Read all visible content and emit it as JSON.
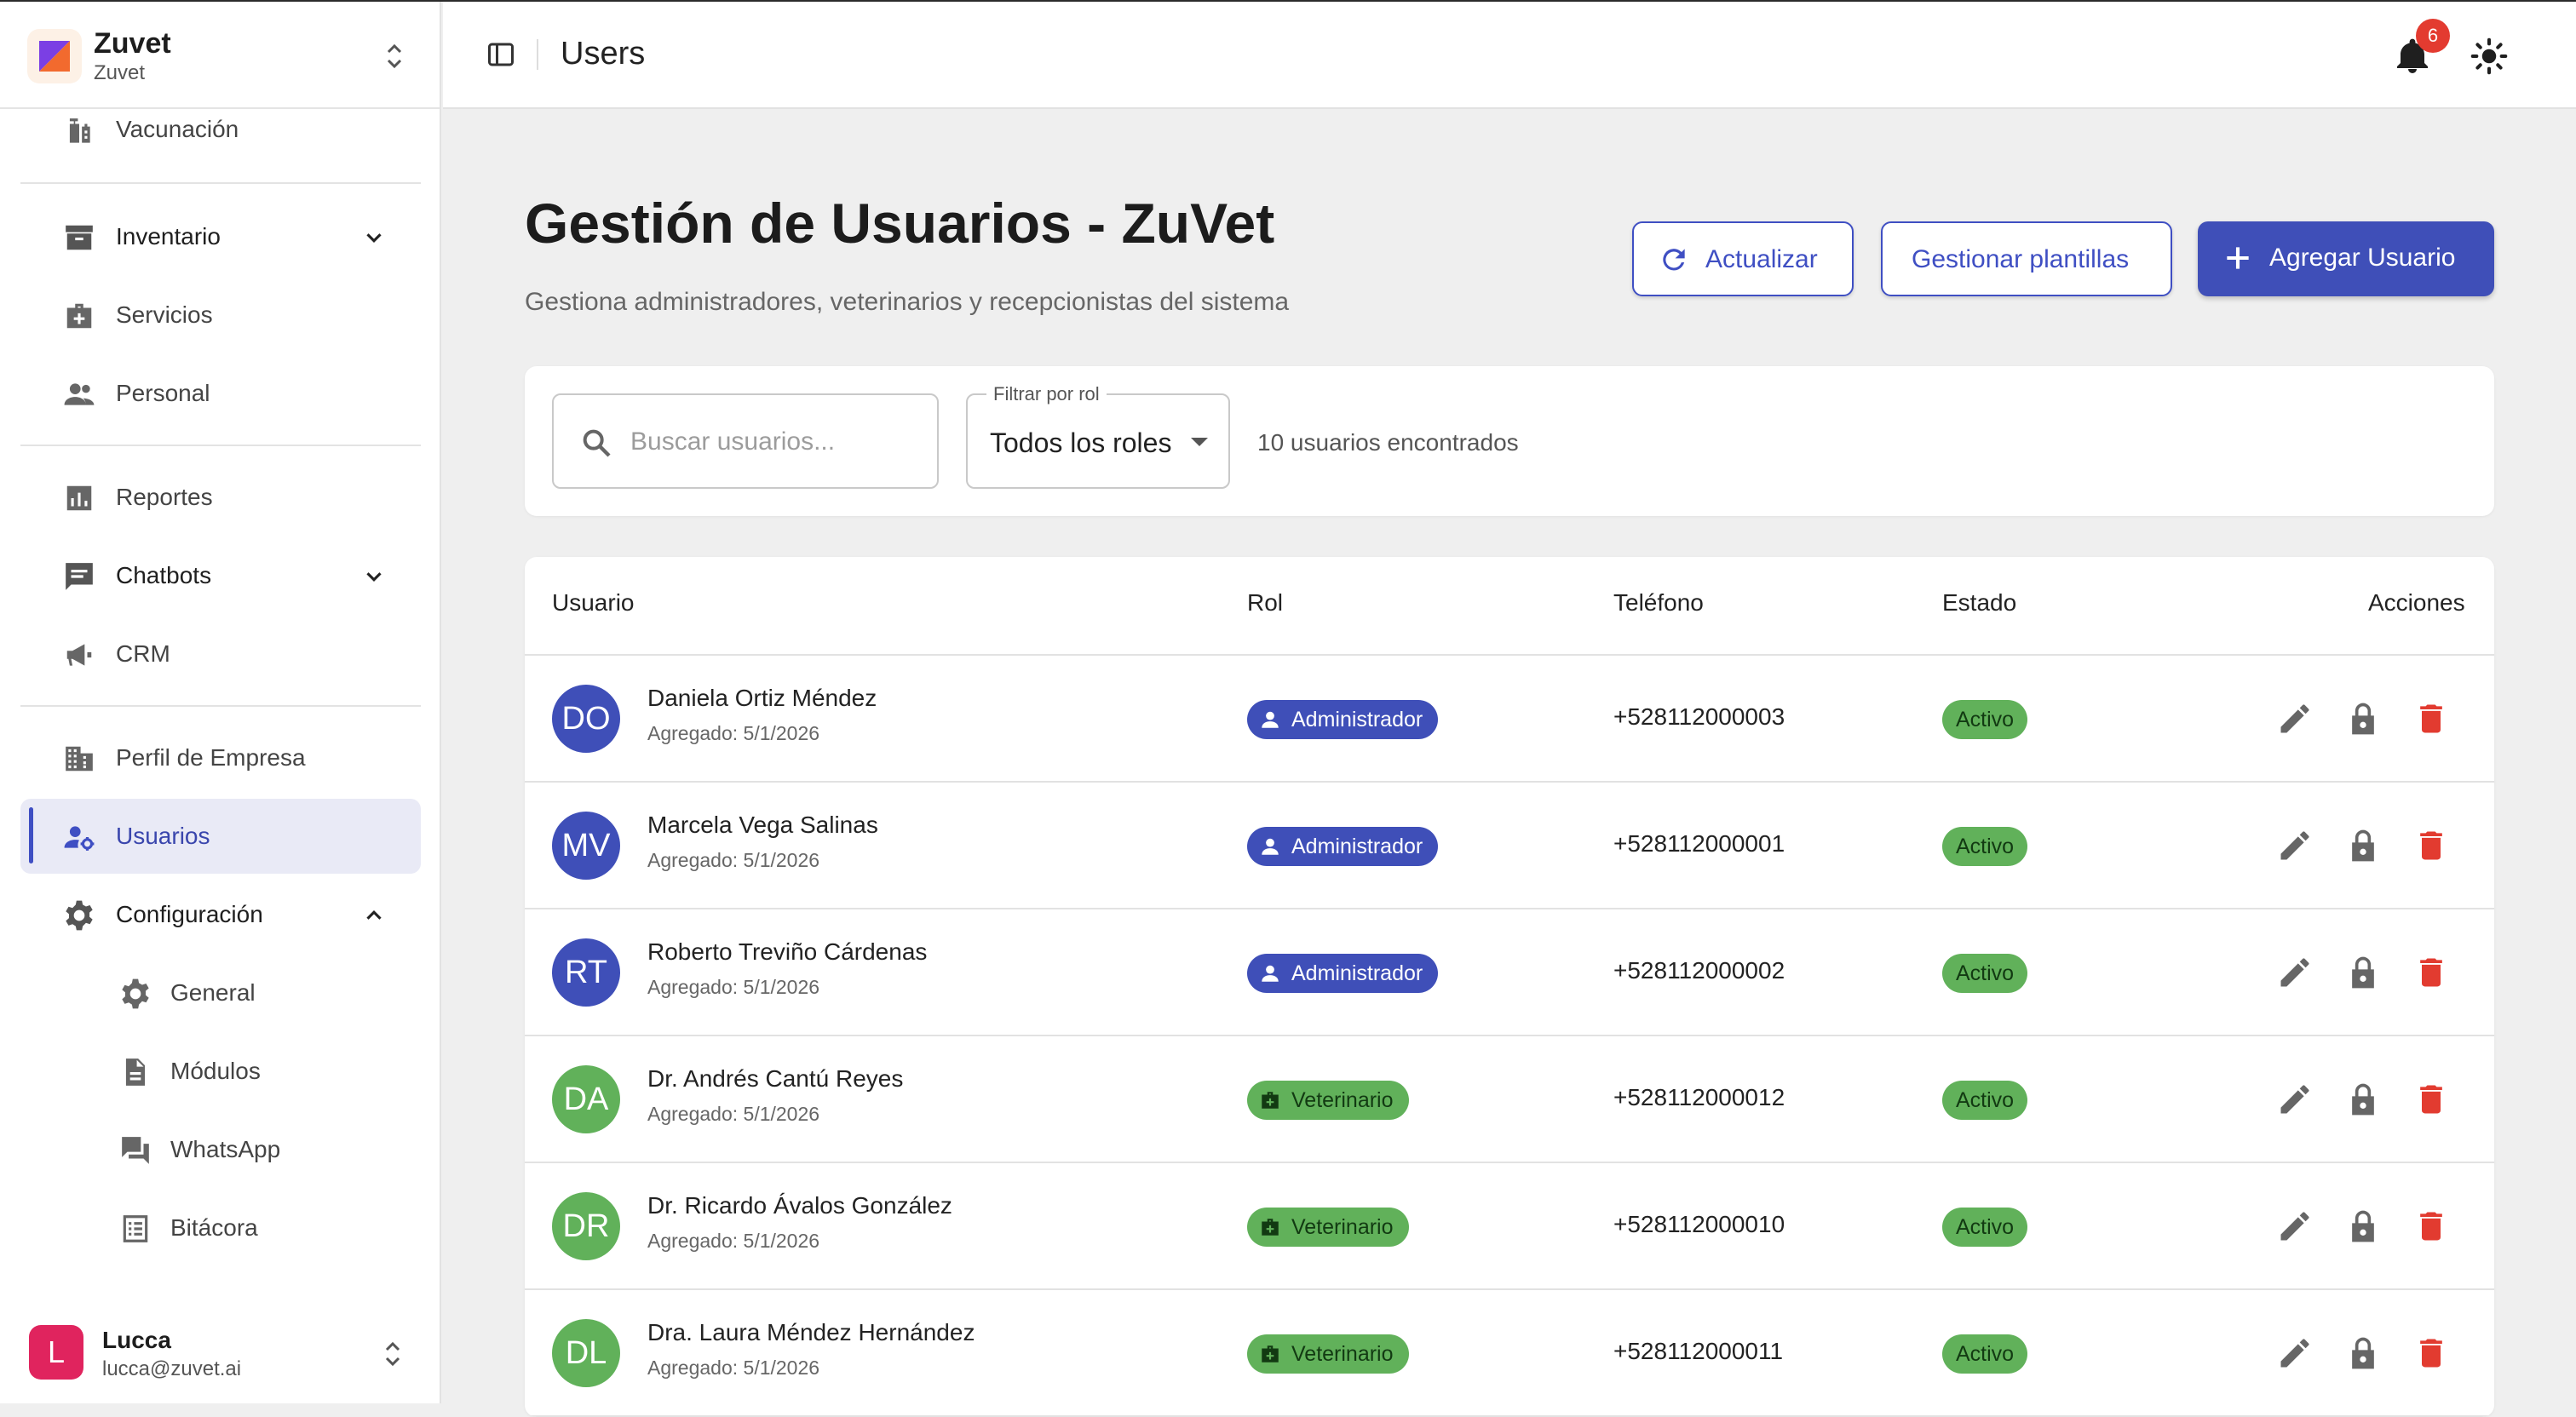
{
  "app": {
    "brand_name": "Zuvet",
    "brand_sub": "Zuvet",
    "accent": "#3f4fb8",
    "header_title": "Users",
    "notification_count": "6"
  },
  "sidebar": {
    "items": {
      "vacunacion": "Vacunación",
      "inventario": "Inventario",
      "servicios": "Servicios",
      "personal": "Personal",
      "reportes": "Reportes",
      "chatbots": "Chatbots",
      "crm": "CRM",
      "perfil": "Perfil de Empresa",
      "usuarios": "Usuarios",
      "configuracion": "Configuración",
      "general": "General",
      "modulos": "Módulos",
      "whatsapp": "WhatsApp",
      "bitacora": "Bitácora"
    },
    "user": {
      "initial": "L",
      "name": "Lucca",
      "email": "lucca@zuvet.ai"
    }
  },
  "main": {
    "title": "Gestión de Usuarios - ZuVet",
    "subtitle": "Gestiona administradores, veterinarios y recepcionistas del sistema",
    "buttons": {
      "refresh": "Actualizar",
      "templates": "Gestionar plantillas",
      "add": "Agregar Usuario"
    },
    "search_placeholder": "Buscar usuarios...",
    "filter_label": "Filtrar por rol",
    "filter_value": "Todos los roles",
    "results_count": "10 usuarios encontrados",
    "columns": {
      "user": "Usuario",
      "role": "Rol",
      "phone": "Teléfono",
      "status": "Estado",
      "actions": "Acciones"
    },
    "rows": [
      {
        "initials": "DO",
        "name": "Daniela Ortiz Méndez",
        "added": "Agregado: 5/1/2026",
        "role": "Administrador",
        "phone": "+528112000003",
        "status": "Activo"
      },
      {
        "initials": "MV",
        "name": "Marcela Vega Salinas",
        "added": "Agregado: 5/1/2026",
        "role": "Administrador",
        "phone": "+528112000001",
        "status": "Activo"
      },
      {
        "initials": "RT",
        "name": "Roberto Treviño Cárdenas",
        "added": "Agregado: 5/1/2026",
        "role": "Administrador",
        "phone": "+528112000002",
        "status": "Activo"
      },
      {
        "initials": "DA",
        "name": "Dr. Andrés Cantú Reyes",
        "added": "Agregado: 5/1/2026",
        "role": "Veterinario",
        "phone": "+528112000012",
        "status": "Activo"
      },
      {
        "initials": "DR",
        "name": "Dr. Ricardo Ávalos González",
        "added": "Agregado: 5/1/2026",
        "role": "Veterinario",
        "phone": "+528112000010",
        "status": "Activo"
      },
      {
        "initials": "DL",
        "name": "Dra. Laura Méndez Hernández",
        "added": "Agregado: 5/1/2026",
        "role": "Veterinario",
        "phone": "+528112000011",
        "status": "Activo"
      }
    ]
  },
  "colors": {
    "admin_avatar": "#3f4fb8",
    "vet_avatar": "#61b15a",
    "status_active": "#61b15a",
    "delete": "#e23b30"
  }
}
